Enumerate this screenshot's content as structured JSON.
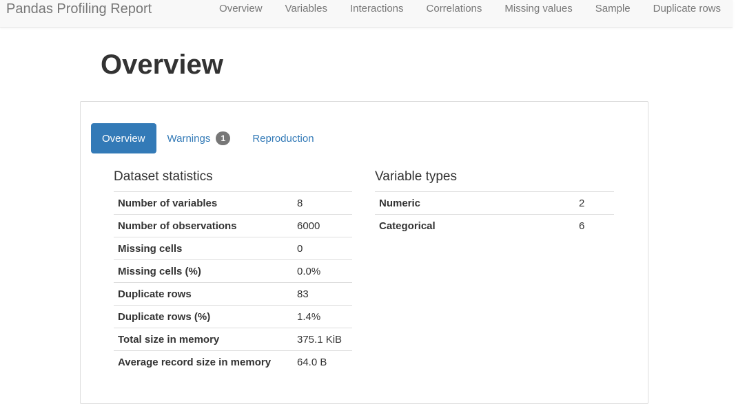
{
  "navbar": {
    "brand": "Pandas Profiling Report",
    "links": [
      "Overview",
      "Variables",
      "Interactions",
      "Correlations",
      "Missing values",
      "Sample",
      "Duplicate rows"
    ]
  },
  "page": {
    "title": "Overview"
  },
  "tabs": [
    {
      "label": "Overview",
      "active": true
    },
    {
      "label": "Warnings",
      "badge": "1"
    },
    {
      "label": "Reproduction"
    }
  ],
  "dataset_statistics": {
    "title": "Dataset statistics",
    "rows": [
      {
        "label": "Number of variables",
        "value": "8"
      },
      {
        "label": "Number of observations",
        "value": "6000"
      },
      {
        "label": "Missing cells",
        "value": "0"
      },
      {
        "label": "Missing cells (%)",
        "value": "0.0%"
      },
      {
        "label": "Duplicate rows",
        "value": "83"
      },
      {
        "label": "Duplicate rows (%)",
        "value": "1.4%"
      },
      {
        "label": "Total size in memory",
        "value": "375.1 KiB"
      },
      {
        "label": "Average record size in memory",
        "value": "64.0 B"
      }
    ]
  },
  "variable_types": {
    "title": "Variable types",
    "rows": [
      {
        "label": "Numeric",
        "value": "2"
      },
      {
        "label": "Categorical",
        "value": "6"
      }
    ]
  },
  "colors": {
    "primary": "#337ab7",
    "navbar_bg": "#f8f8f8",
    "badge_bg": "#777777"
  }
}
